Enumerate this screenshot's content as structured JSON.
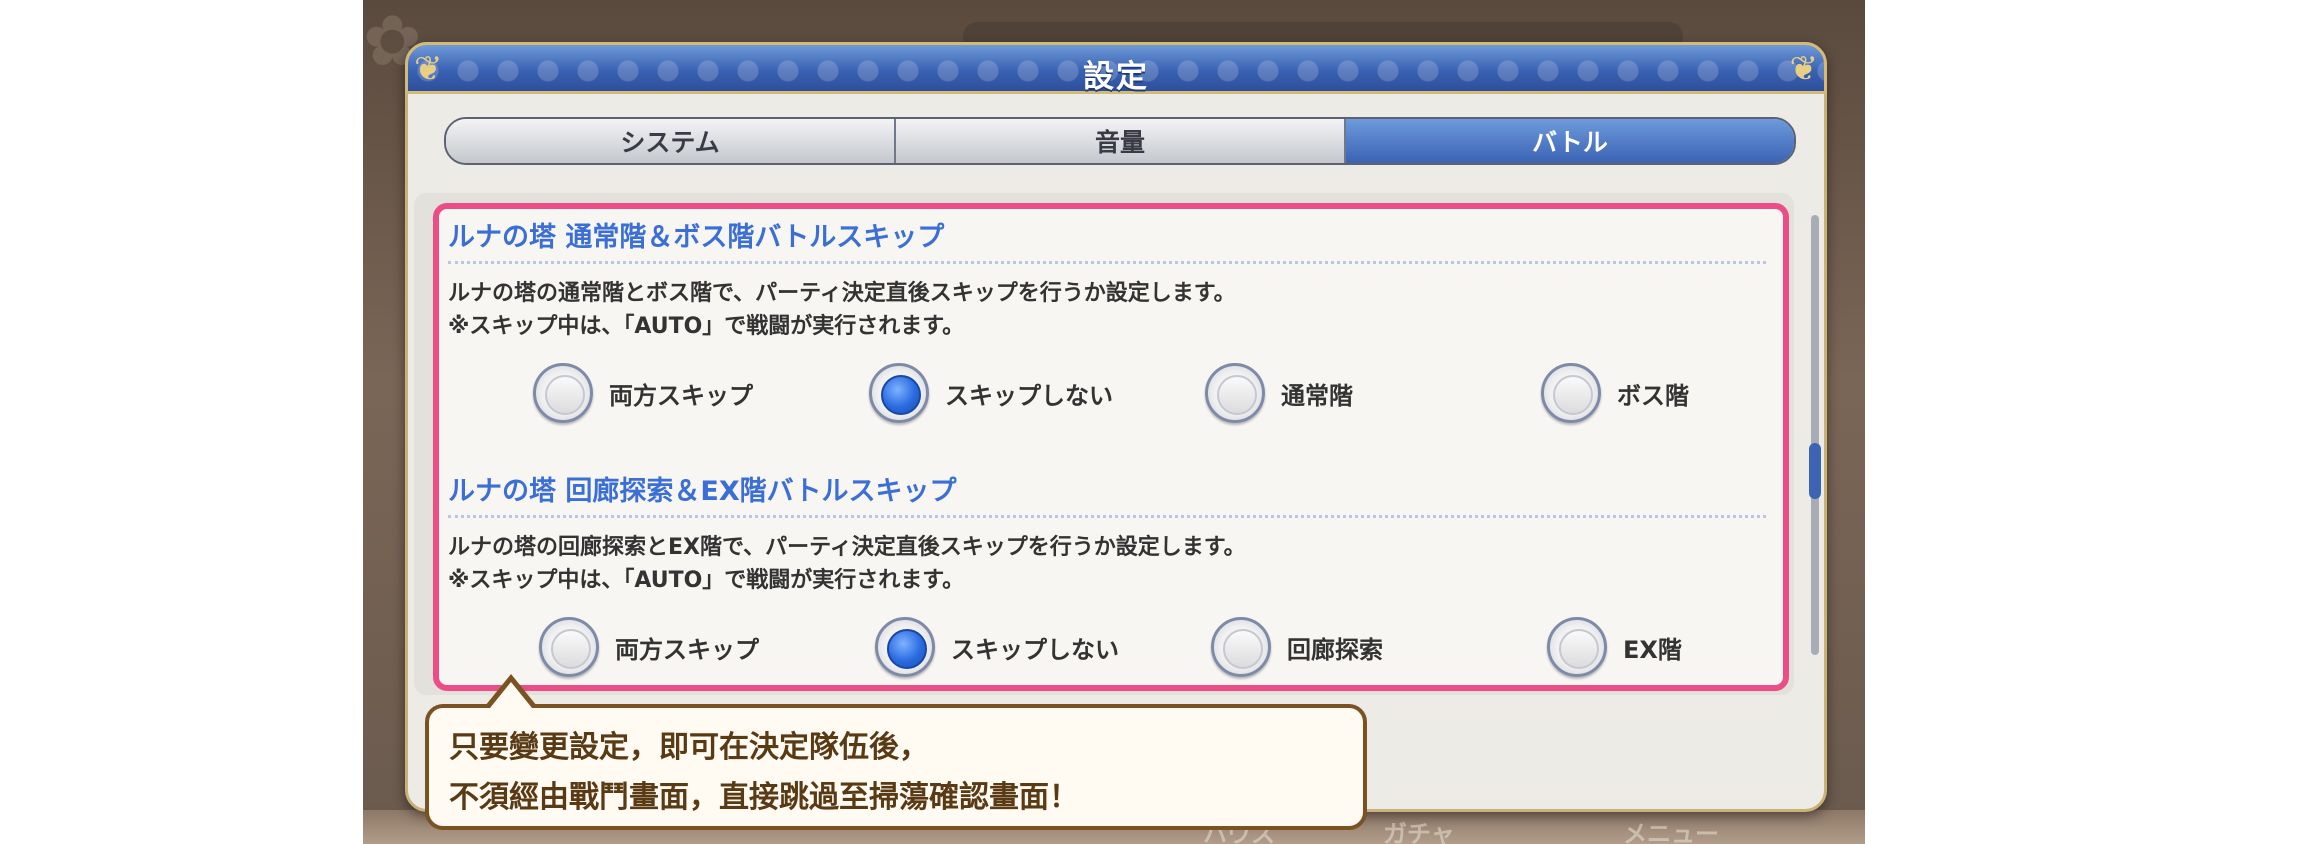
{
  "background": {
    "bottom_labels": [
      "ハウス",
      "ガチャ",
      "メニュー"
    ]
  },
  "dialog": {
    "title": "設定",
    "tabs": [
      {
        "label": "システム",
        "active": false
      },
      {
        "label": "音量",
        "active": false
      },
      {
        "label": "バトル",
        "active": true
      }
    ]
  },
  "sections": [
    {
      "title": "ルナの塔 通常階＆ボス階バトルスキップ",
      "desc_line1": "ルナの塔の通常階とボス階で、パーティ決定直後スキップを行うか設定します。",
      "desc_line2": "※スキップ中は、「AUTO」で戦闘が実行されます。",
      "options": [
        {
          "label": "両方スキップ",
          "selected": false
        },
        {
          "label": "スキップしない",
          "selected": true
        },
        {
          "label": "通常階",
          "selected": false
        },
        {
          "label": "ボス階",
          "selected": false
        }
      ]
    },
    {
      "title": "ルナの塔 回廊探索＆EX階バトルスキップ",
      "desc_line1": "ルナの塔の回廊探索とEX階で、パーティ決定直後スキップを行うか設定します。",
      "desc_line2": "※スキップ中は、「AUTO」で戦闘が実行されます。",
      "options": [
        {
          "label": "両方スキップ",
          "selected": false
        },
        {
          "label": "スキップしない",
          "selected": true
        },
        {
          "label": "回廊探索",
          "selected": false
        },
        {
          "label": "EX階",
          "selected": false
        }
      ]
    }
  ],
  "callout": {
    "line1": "只要變更設定，即可在決定隊伍後，",
    "line2": "不須經由戰鬥畫面，直接跳過至掃蕩確認畫面！"
  },
  "colors": {
    "accent_blue": "#3b62b4",
    "highlight_pink": "#ec4d87",
    "callout_border": "#7b5323"
  }
}
